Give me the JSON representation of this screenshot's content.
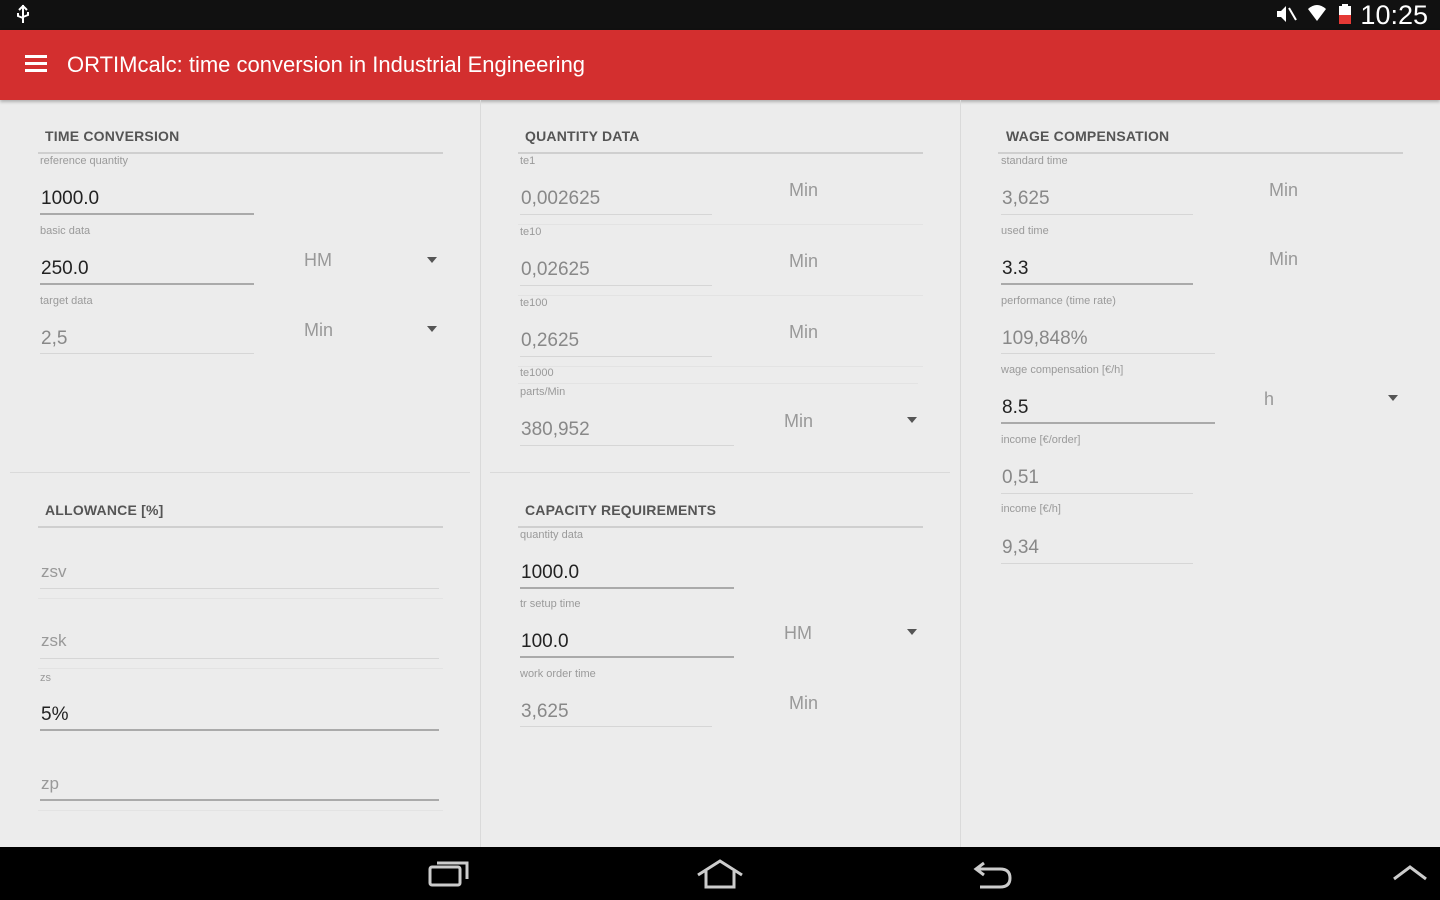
{
  "status_bar": {
    "time": "10:25"
  },
  "app": {
    "title": "ORTIMcalc: time conversion in Industrial Engineering"
  },
  "time_conversion": {
    "title": "TIME CONVERSION",
    "reference_quantity": {
      "label": "reference quantity",
      "value": "1000.0"
    },
    "basic_data": {
      "label": "basic data",
      "value": "250.0",
      "unit": "HM"
    },
    "target_data": {
      "label": "target data",
      "value": "2,5",
      "unit": "Min"
    }
  },
  "allowance": {
    "title": "ALLOWANCE [%]",
    "zsv": {
      "placeholder": "zsv"
    },
    "zsk": {
      "placeholder": "zsk"
    },
    "zs": {
      "label": "zs",
      "value": "5%"
    },
    "zp": {
      "placeholder": "zp"
    }
  },
  "quantity_data": {
    "title": "QUANTITY DATA",
    "te1": {
      "label": "te1",
      "value": "0,002625",
      "unit": "Min"
    },
    "te10": {
      "label": "te10",
      "value": "0,02625",
      "unit": "Min"
    },
    "te100": {
      "label": "te100",
      "value": "0,2625",
      "unit": "Min"
    },
    "te1000": {
      "label": "te1000"
    },
    "parts_min": {
      "label": "parts/Min",
      "value": "380,952",
      "unit": "Min"
    }
  },
  "capacity_requirements": {
    "title": "CAPACITY REQUIREMENTS",
    "quantity_data": {
      "label": "quantity data",
      "value": "1000.0"
    },
    "setup_time": {
      "label": "tr setup time",
      "value": "100.0",
      "unit": "HM"
    },
    "work_order_time": {
      "label": "work order time",
      "value": "3,625",
      "unit": "Min"
    }
  },
  "wage_compensation": {
    "title": "WAGE COMPENSATION",
    "standard_time": {
      "label": "standard time",
      "value": "3,625",
      "unit": "Min"
    },
    "used_time": {
      "label": "used time",
      "value": "3.3",
      "unit": "Min"
    },
    "performance": {
      "label": "performance (time rate)",
      "value": "109,848%"
    },
    "wage_compensation": {
      "label": "wage compensation [€/h]",
      "value": "8.5",
      "unit": "h"
    },
    "income_order": {
      "label": "income [€/order]",
      "value": "0,51"
    },
    "income_h": {
      "label": "income [€/h]",
      "value": "9,34"
    }
  },
  "icons": {
    "status": [
      "usb-icon",
      "mute-icon",
      "wifi-icon",
      "battery-icon"
    ],
    "nav": [
      "recent-apps-icon",
      "home-icon",
      "back-icon",
      "chevron-up-icon"
    ]
  }
}
